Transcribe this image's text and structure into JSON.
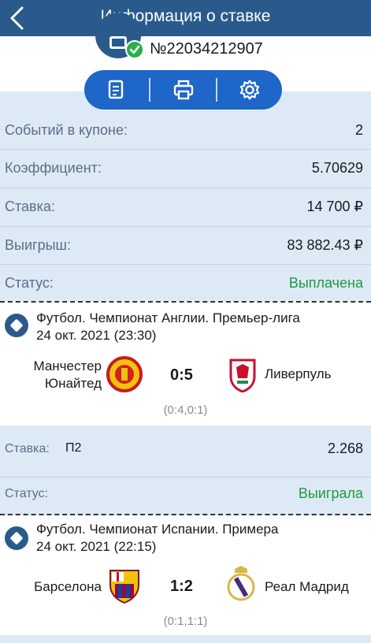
{
  "header": {
    "title": "Информация о ставке"
  },
  "coupon": {
    "number": "№22034212907"
  },
  "summary": {
    "rows": [
      {
        "label": "Событий в купоне:",
        "value": "2"
      },
      {
        "label": "Коэффициент:",
        "value": "5.70629"
      },
      {
        "label": "Ставка:",
        "value": "14 700 ₽"
      },
      {
        "label": "Выигрыш:",
        "value": "83 882.43 ₽"
      },
      {
        "label": "Статус:",
        "value": "Выплачена"
      }
    ]
  },
  "events": [
    {
      "title": "Футбол. Чемпионат Англии. Премьер-лига",
      "date": "24 окт. 2021 (23:30)",
      "home_line1": "Манчестер",
      "home_line2": "Юнайтед",
      "away": "Ливерпуль",
      "score": "0:5",
      "periods": "(0:4,0:1)",
      "bet_label": "Ставка:",
      "bet_pick": "П2",
      "bet_odds": "2.268",
      "status_label": "Статус:",
      "status_value": "Выиграла"
    },
    {
      "title": "Футбол. Чемпионат Испании. Примера",
      "date": "24 окт. 2021 (22:15)",
      "home": "Барселона",
      "away": "Реал Мадрид",
      "score": "1:2",
      "periods": "(0:1,1:1)"
    }
  ],
  "colors": {
    "header_bg": "#2a5a8c",
    "toolbar_bg": "#1e66c8",
    "panel_bg": "#ddeaf6",
    "success": "#1f9a3b"
  },
  "icons": {
    "back": "chevron-left-icon",
    "copy": "document-copy-icon",
    "print": "printer-icon",
    "settings": "gear-icon",
    "verified": "check-circle-icon",
    "sport": "football-icon"
  }
}
